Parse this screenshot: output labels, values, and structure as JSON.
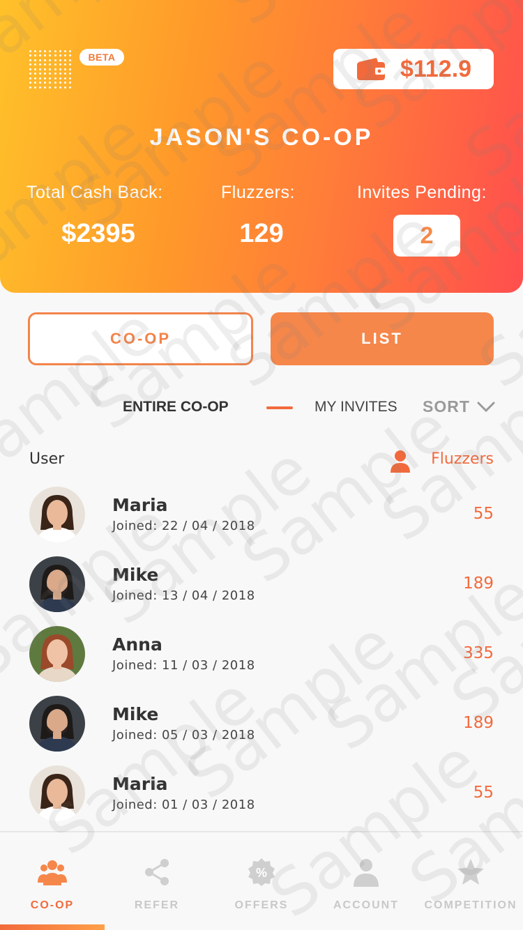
{
  "header": {
    "beta_label": "BETA",
    "balance": "$112.9",
    "title": "JASON'S CO-OP",
    "stats": {
      "cashback_label": "Total Cash Back:",
      "cashback_value": "$2395",
      "fluzzers_label": "Fluzzers:",
      "fluzzers_value": "129",
      "pending_label": "Invites Pending:",
      "pending_value": "2"
    }
  },
  "view_toggle": {
    "coop_label": "CO-OP",
    "list_label": "LIST"
  },
  "filters": {
    "entire_label": "ENTIRE CO-OP",
    "invites_label": "MY INVITES",
    "sort_label": "SORT"
  },
  "list": {
    "user_header": "User",
    "fluzzers_header": "Fluzzers",
    "rows": [
      {
        "name": "Maria",
        "joined": "Joined:  22 / 04 / 2018",
        "count": "55"
      },
      {
        "name": "Mike",
        "joined": "Joined:  13 / 04 / 2018",
        "count": "189"
      },
      {
        "name": "Anna",
        "joined": "Joined:  11 / 03 / 2018",
        "count": "335"
      },
      {
        "name": "Mike",
        "joined": "Joined:  05 / 03 / 2018",
        "count": "189"
      },
      {
        "name": "Maria",
        "joined": "Joined:  01 / 03 / 2018",
        "count": "55"
      }
    ]
  },
  "tabs": [
    {
      "label": "CO-OP",
      "icon": "group-icon"
    },
    {
      "label": "REFER",
      "icon": "share-icon"
    },
    {
      "label": "OFFERS",
      "icon": "percent-badge-icon"
    },
    {
      "label": "ACCOUNT",
      "icon": "user-icon"
    },
    {
      "label": "COMPETITION",
      "icon": "star-icon"
    }
  ],
  "watermark_text": "Sample",
  "colors": {
    "accent": "#f26a3c",
    "accent_light": "#f5874b",
    "gradient_start": "#ffc12a",
    "gradient_end": "#ff4e4e",
    "tab_inactive": "#c8c8c8"
  }
}
